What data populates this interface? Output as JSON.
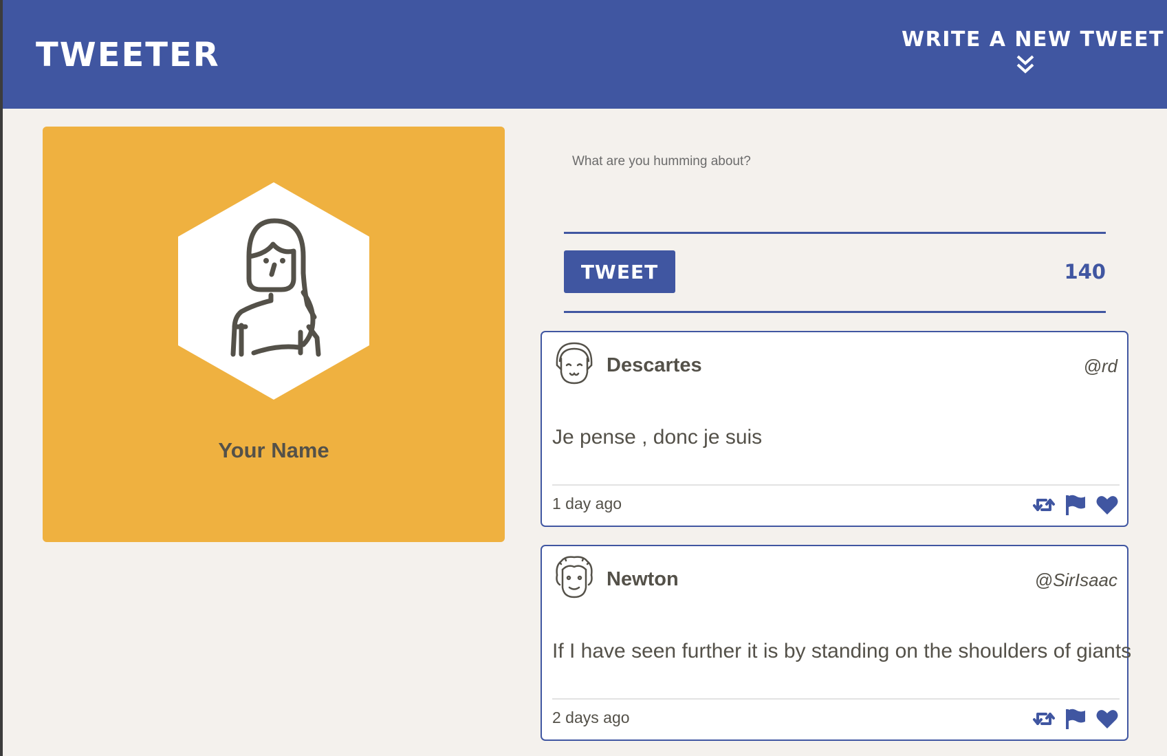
{
  "nav": {
    "brand": "TWEETER",
    "compose_label": "WRITE A NEW TWEET",
    "compose_icon": "double-chevron-down-icon"
  },
  "profile": {
    "name": "Your Name",
    "avatar_icon": "woman-avatar-icon",
    "card_color": "#efb140"
  },
  "composer": {
    "placeholder": "What are you humming about?",
    "value": "",
    "button_label": "TWEET",
    "counter": "140"
  },
  "tweets": [
    {
      "author": "Descartes",
      "handle": "@rd",
      "text": "Je pense , donc je suis",
      "time": "1 day ago",
      "avatar_icon": "descartes-avatar-icon"
    },
    {
      "author": "Newton",
      "handle": "@SirIsaac",
      "text": "If I have seen further it is by standing on the shoulders of giants",
      "time": "2 days ago",
      "avatar_icon": "newton-avatar-icon"
    }
  ],
  "actions": {
    "icons": [
      "retweet-icon",
      "flag-icon",
      "heart-icon"
    ]
  },
  "colors": {
    "accent": "#4056a1",
    "background": "#f4f1ed",
    "text": "#545149"
  }
}
